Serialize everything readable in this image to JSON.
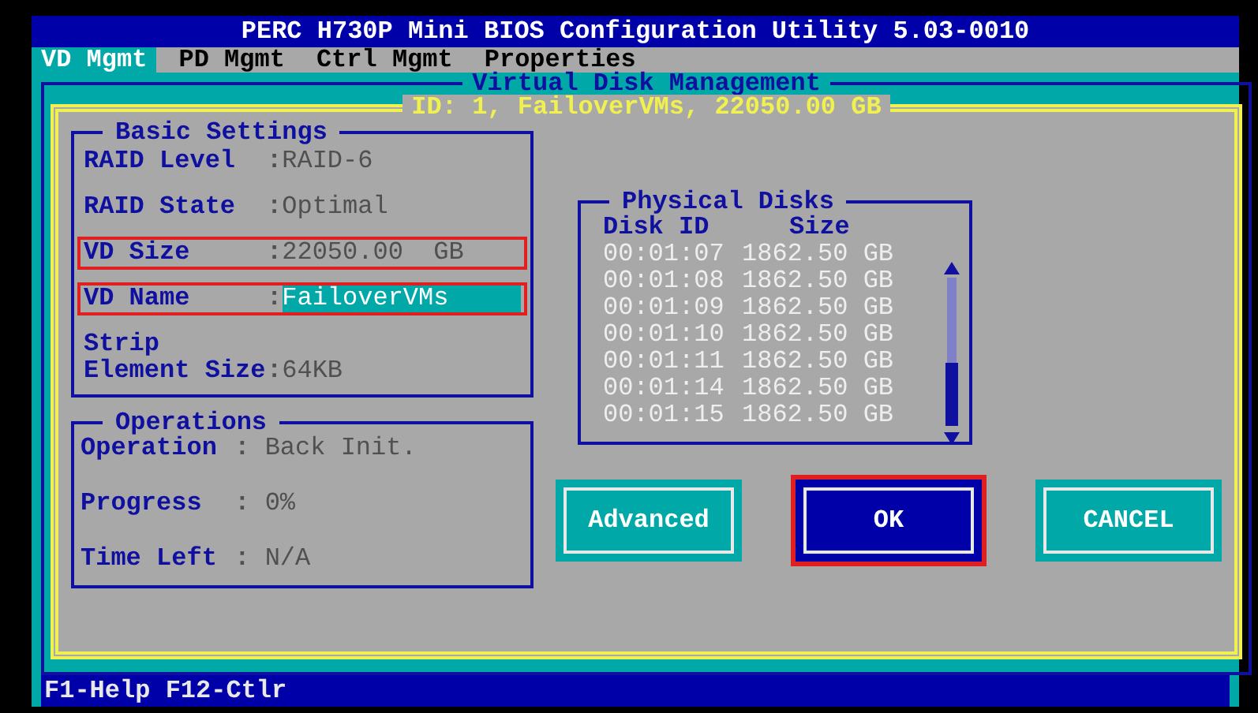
{
  "window": {
    "title": "PERC H730P Mini BIOS Configuration Utility 5.03-0010"
  },
  "tabs": [
    {
      "label": "VD Mgmt",
      "selected": true
    },
    {
      "label": "PD Mgmt",
      "selected": false
    },
    {
      "label": "Ctrl Mgmt",
      "selected": false
    },
    {
      "label": "Properties",
      "selected": false
    }
  ],
  "panel": {
    "title": "Virtual Disk Management",
    "subtitle": "ID: 1, FailoverVMs, 22050.00 GB"
  },
  "basic_settings": {
    "title": "Basic Settings",
    "rows": [
      {
        "label": "RAID Level",
        "separator": ":",
        "value": "RAID-6",
        "highlighted": false,
        "editing": false
      },
      {
        "label": "RAID State",
        "separator": ":",
        "value": "Optimal",
        "highlighted": false,
        "editing": false
      },
      {
        "label": "VD Size",
        "separator": ":",
        "value": "22050.00  GB",
        "highlighted": true,
        "editing": false
      },
      {
        "label": "VD Name",
        "separator": ":",
        "value": "FailoverVMs",
        "highlighted": true,
        "editing": true
      },
      {
        "label": "Strip Element Size",
        "separator": ":",
        "value": "64KB",
        "highlighted": false,
        "editing": false
      }
    ]
  },
  "operations": {
    "title": "Operations",
    "rows": [
      {
        "label": "Operation",
        "separator": " : ",
        "value": "Back Init."
      },
      {
        "label": "Progress",
        "separator": " : ",
        "value": "0%"
      },
      {
        "label": "Time Left",
        "separator": " : ",
        "value": "N/A"
      }
    ]
  },
  "physical_disks": {
    "title": "Physical Disks",
    "columns": [
      "Disk ID",
      "Size"
    ],
    "rows": [
      {
        "disk_id": "00:01:07",
        "size": "1862.50 GB"
      },
      {
        "disk_id": "00:01:08",
        "size": "1862.50 GB"
      },
      {
        "disk_id": "00:01:09",
        "size": "1862.50 GB"
      },
      {
        "disk_id": "00:01:10",
        "size": "1862.50 GB"
      },
      {
        "disk_id": "00:01:11",
        "size": "1862.50 GB"
      },
      {
        "disk_id": "00:01:14",
        "size": "1862.50 GB"
      },
      {
        "disk_id": "00:01:15",
        "size": "1862.50 GB"
      }
    ]
  },
  "buttons": [
    {
      "label": "Advanced",
      "selected": false,
      "highlighted": false
    },
    {
      "label": "OK",
      "selected": true,
      "highlighted": true
    },
    {
      "label": "CANCEL",
      "selected": false,
      "highlighted": false
    }
  ],
  "status_bar": "F1-Help F12-Ctlr"
}
